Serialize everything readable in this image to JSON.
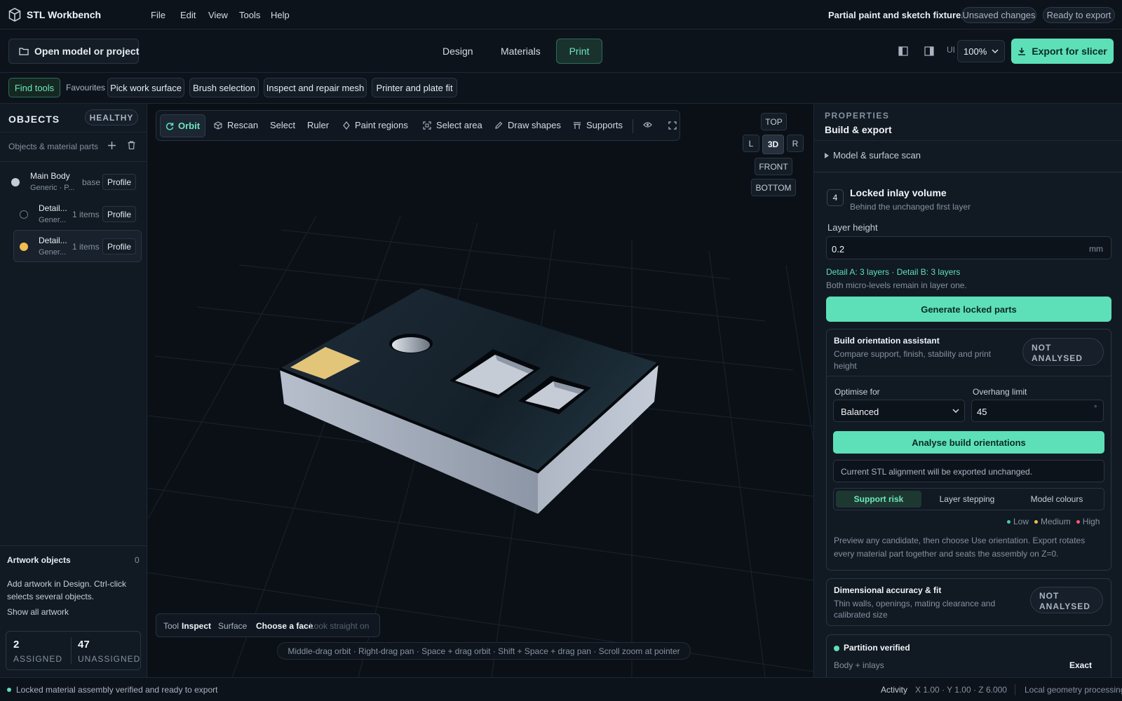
{
  "app": {
    "title": "STL Workbench",
    "filename": "Partial paint and sketch fixture.stl",
    "badge_unsaved": "Unsaved changes",
    "badge_ready": "Ready to export"
  },
  "menu": [
    "File",
    "Edit",
    "View",
    "Tools",
    "Help"
  ],
  "toolbar": {
    "open_label": "Open model or project",
    "tabs": [
      "Design",
      "Materials",
      "Print"
    ],
    "active_tab": "Print",
    "ui_label": "UI",
    "zoom_value": "100%",
    "export_label": "Export for slicer"
  },
  "quickbar": {
    "find_tools": "Find tools",
    "favourites": "Favourites",
    "items": [
      "Pick work surface",
      "Brush selection",
      "Inspect and repair mesh",
      "Printer and plate fit"
    ]
  },
  "objects": {
    "title": "OBJECTS",
    "status": "HEALTHY",
    "subtitle": "Objects & material parts",
    "items": [
      {
        "name": "Main Body",
        "sub": "Generic · P...",
        "meta": "base",
        "profile": "Profile",
        "color": "#c5cbd3"
      },
      {
        "name": "Detail...",
        "sub": "Gener...",
        "meta": "1 items",
        "profile": "Profile",
        "color": "#0d131b"
      },
      {
        "name": "Detail...",
        "sub": "Gener...",
        "meta": "1 items",
        "profile": "Profile",
        "color": "#f0bd4f"
      }
    ],
    "artwork_title": "Artwork objects",
    "artwork_count": "0",
    "artwork_help": "Add artwork in Design. Ctrl-click selects several objects.",
    "show_all": "Show all artwork",
    "assigned_num": "2",
    "assigned_label": "ASSIGNED",
    "unassigned_num": "47",
    "unassigned_label": "UNASSIGNED"
  },
  "viewport": {
    "tools": [
      "Orbit",
      "Rescan",
      "Select",
      "Ruler",
      "Paint regions",
      "Select area",
      "Draw shapes",
      "Supports"
    ],
    "active_tool": "Orbit",
    "views": {
      "top": "TOP",
      "left": "L",
      "threed": "3D",
      "right": "R",
      "front": "FRONT",
      "bottom": "BOTTOM"
    },
    "status_tool_label": "Tool",
    "status_tool_value": "Inspect",
    "status_surface_label": "Surface",
    "status_surface_value": "Choose a face",
    "status_look": "Look straight on",
    "hint": "Middle-drag orbit · Right-drag pan · Space + drag orbit · Shift + Space + drag pan · Scroll zoom at pointer"
  },
  "properties": {
    "label": "PROPERTIES",
    "title": "Build & export",
    "scan_section": "Model & surface scan",
    "step_number": "4",
    "step_title": "Locked inlay volume",
    "step_sub": "Behind the unchanged first layer",
    "layer_height_label": "Layer height",
    "layer_height_value": "0.2",
    "layer_height_unit": "mm",
    "layer_info": "Detail A: 3 layers · Detail B: 3 layers",
    "layer_note": "Both micro-levels remain in layer one.",
    "generate_label": "Generate locked parts",
    "orientation": {
      "title": "Build orientation assistant",
      "desc": "Compare support, finish, stability and print height",
      "status": "NOT ANALYSED",
      "optimise_label": "Optimise for",
      "optimise_value": "Balanced",
      "overhang_label": "Overhang limit",
      "overhang_value": "45",
      "overhang_unit": "°",
      "analyse_label": "Analyse build orientations",
      "alignment_note": "Current STL alignment will be exported unchanged.",
      "segments": [
        "Support risk",
        "Layer stepping",
        "Model colours"
      ],
      "active_segment": "Support risk",
      "legend": [
        {
          "label": "Low",
          "color": "#3fd0a8"
        },
        {
          "label": "Medium",
          "color": "#f0bd4f"
        },
        {
          "label": "High",
          "color": "#ef5f6a"
        }
      ],
      "footer": "Preview any candidate, then choose Use orientation. Export rotates every material part together and seats the assembly on Z=0."
    },
    "accuracy": {
      "title": "Dimensional accuracy & fit",
      "desc": "Thin walls, openings, mating clearance and calibrated size",
      "status": "NOT ANALYSED"
    },
    "partition": {
      "title": "Partition verified",
      "row_label": "Body + inlays",
      "row_value": "Exact"
    }
  },
  "statusbar": {
    "message": "Locked material assembly verified and ready to export",
    "activity": "Activity",
    "scale": "X 1.00 · Y 1.00 · Z 6.000",
    "processing": "Local geometry processing"
  },
  "colors": {
    "accent": "#5de0b8",
    "background": "#0d131b",
    "panel": "#111923",
    "inlay_gold": "#e3c57a"
  }
}
